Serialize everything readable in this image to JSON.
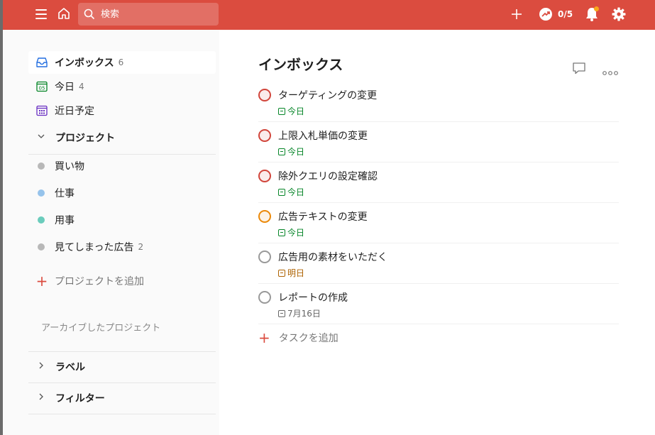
{
  "topbar": {
    "search_placeholder": "検索",
    "karma": "0/5",
    "colors": {
      "bar": "#db4c3f",
      "notification_dot": "#f9a71b"
    },
    "icons": [
      "menu-icon",
      "home-icon",
      "search-icon",
      "add-icon",
      "karma-icon",
      "bell-icon",
      "gear-icon"
    ]
  },
  "sidebar": {
    "inbox": {
      "label": "インボックス",
      "count": "6"
    },
    "today": {
      "label": "今日",
      "count": "4",
      "calendar_day": "05"
    },
    "upcoming": {
      "label": "近日予定"
    },
    "projects_heading": "プロジェクト",
    "projects": [
      {
        "label": "買い物",
        "count": "",
        "color": "#b8b8b8"
      },
      {
        "label": "仕事",
        "count": "",
        "color": "#96c3eb"
      },
      {
        "label": "用事",
        "count": "",
        "color": "#6accbc"
      },
      {
        "label": "見てしまった広告",
        "count": "2",
        "color": "#b8b8b8"
      }
    ],
    "add_project": "プロジェクトを追加",
    "archived": "アーカイブしたプロジェクト",
    "labels_heading": "ラベル",
    "filters_heading": "フィルター"
  },
  "main": {
    "title": "インボックス",
    "tasks": [
      {
        "title": "ターゲティングの変更",
        "due": "今日",
        "priority_color": "#d1453b",
        "due_color": "#058527"
      },
      {
        "title": "上限入札単価の変更",
        "due": "今日",
        "priority_color": "#d1453b",
        "due_color": "#058527"
      },
      {
        "title": "除外クエリの設定確認",
        "due": "今日",
        "priority_color": "#d1453b",
        "due_color": "#058527"
      },
      {
        "title": "広告テキストの変更",
        "due": "今日",
        "priority_color": "#eb8909",
        "due_color": "#058527"
      },
      {
        "title": "広告用の素材をいただく",
        "due": "明日",
        "priority_color": "#999999",
        "due_color": "#ad6200"
      },
      {
        "title": "レポートの作成",
        "due": "7月16日",
        "priority_color": "#999999",
        "due_color": "#666666"
      }
    ],
    "add_task": "タスクを追加"
  }
}
